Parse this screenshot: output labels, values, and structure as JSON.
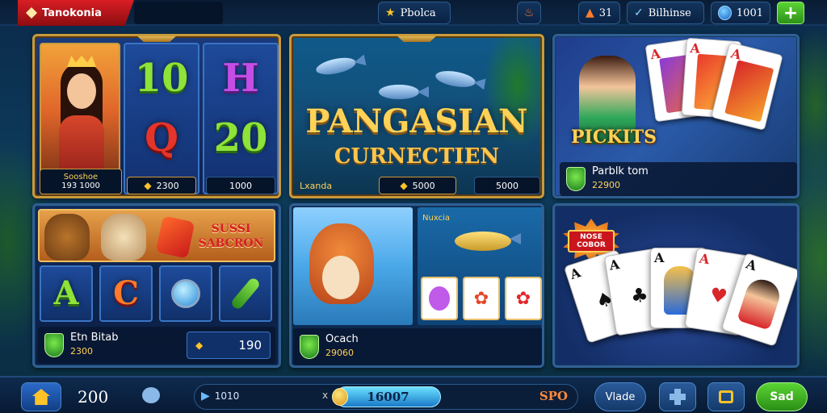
{
  "topbar": {
    "brand": "Tanokonia",
    "center_value": "Pbolca",
    "flame_value": "31",
    "store_label": "Bilhinse",
    "gems": "1001"
  },
  "panel1": {
    "tag_title": "Sooshoe",
    "tag_sub": "193 1000",
    "symbols": [
      "10",
      "H",
      "Q",
      "20"
    ],
    "bet": "2300",
    "win": "1000"
  },
  "panel2": {
    "title": "PANGASIAN",
    "subtitle": "CURNECTIEN",
    "label": "Lxanda",
    "coins": "5000",
    "max": "5000"
  },
  "panel3": {
    "title": "PICKITS",
    "name": "Parblk tom",
    "amount": "22900",
    "cards": [
      "A",
      "A",
      "A"
    ]
  },
  "panel4": {
    "banner": "SUSSI SABCRON",
    "tiles": [
      "A",
      "C"
    ],
    "name": "Etn Bitab",
    "amount": "2300",
    "value": "190"
  },
  "panel5": {
    "label": "Nuxcia",
    "name": "Ocach",
    "amount": "29060"
  },
  "panel6": {
    "badge": "NOSE COBOR",
    "cards": [
      "A",
      "A",
      "A",
      "A",
      "A"
    ]
  },
  "bottombar": {
    "balance": "200",
    "progress_left": "1010",
    "progress_x": "x",
    "progress_value": "16007",
    "progress_fraction": 0.45,
    "progress_right": "SPO",
    "mode_label": "Vlade",
    "send_label": "Sad"
  },
  "colors": {
    "gold": "#ffc329",
    "frame": "#c89a3c",
    "green": "#5ad434",
    "red": "#d81e24"
  }
}
